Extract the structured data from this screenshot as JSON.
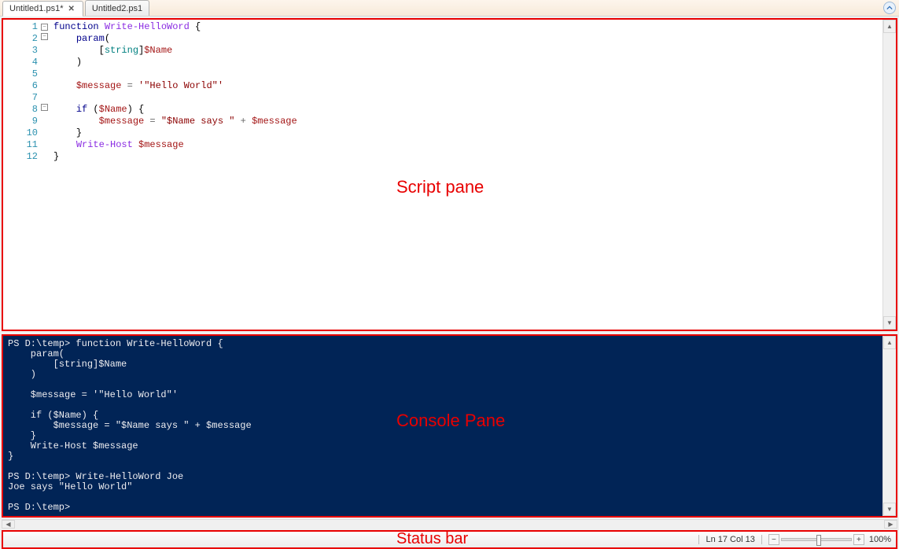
{
  "tabs": [
    {
      "label": "Untitled1.ps1*",
      "active": true
    },
    {
      "label": "Untitled2.ps1",
      "active": false
    }
  ],
  "script": {
    "annotation": "Script pane",
    "line_numbers": [
      "1",
      "2",
      "3",
      "4",
      "5",
      "6",
      "7",
      "8",
      "9",
      "10",
      "11",
      "12"
    ],
    "code": {
      "l1_kw": "function",
      "l1_cmd": "Write-HelloWord",
      "l1_brace": " {",
      "l2_kw": "param",
      "l2_paren": "(",
      "l3_open": "[",
      "l3_type": "string",
      "l3_close": "]",
      "l3_var": "$Name",
      "l4_paren": ")",
      "l6_var": "$message",
      "l6_eq": " = ",
      "l6_str": "'\"Hello World\"'",
      "l8_kw": "if",
      "l8_open": " (",
      "l8_var": "$Name",
      "l8_close": ") {",
      "l9_var": "$message",
      "l9_eq": " = ",
      "l9_str1": "\"$Name says \"",
      "l9_plus": " + ",
      "l9_var2": "$message",
      "l10_brace": "}",
      "l11_cmd": "Write-Host",
      "l11_sp": " ",
      "l11_var": "$message",
      "l12_brace": "}"
    }
  },
  "console": {
    "annotation": "Console Pane",
    "text": "PS D:\\temp> function Write-HelloWord {\n    param(\n        [string]$Name\n    )\n\n    $message = '\"Hello World\"'\n\n    if ($Name) {\n        $message = \"$Name says \" + $message\n    }\n    Write-Host $message\n}\n\nPS D:\\temp> Write-HelloWord Joe\nJoe says \"Hello World\"\n\nPS D:\\temp>"
  },
  "statusbar": {
    "annotation": "Status bar",
    "position": "Ln 17  Col 13",
    "zoom": "100%"
  },
  "icons": {
    "minus": "−",
    "close": "✕",
    "up": "▲",
    "down": "▼",
    "left": "◀",
    "right": "▶"
  }
}
